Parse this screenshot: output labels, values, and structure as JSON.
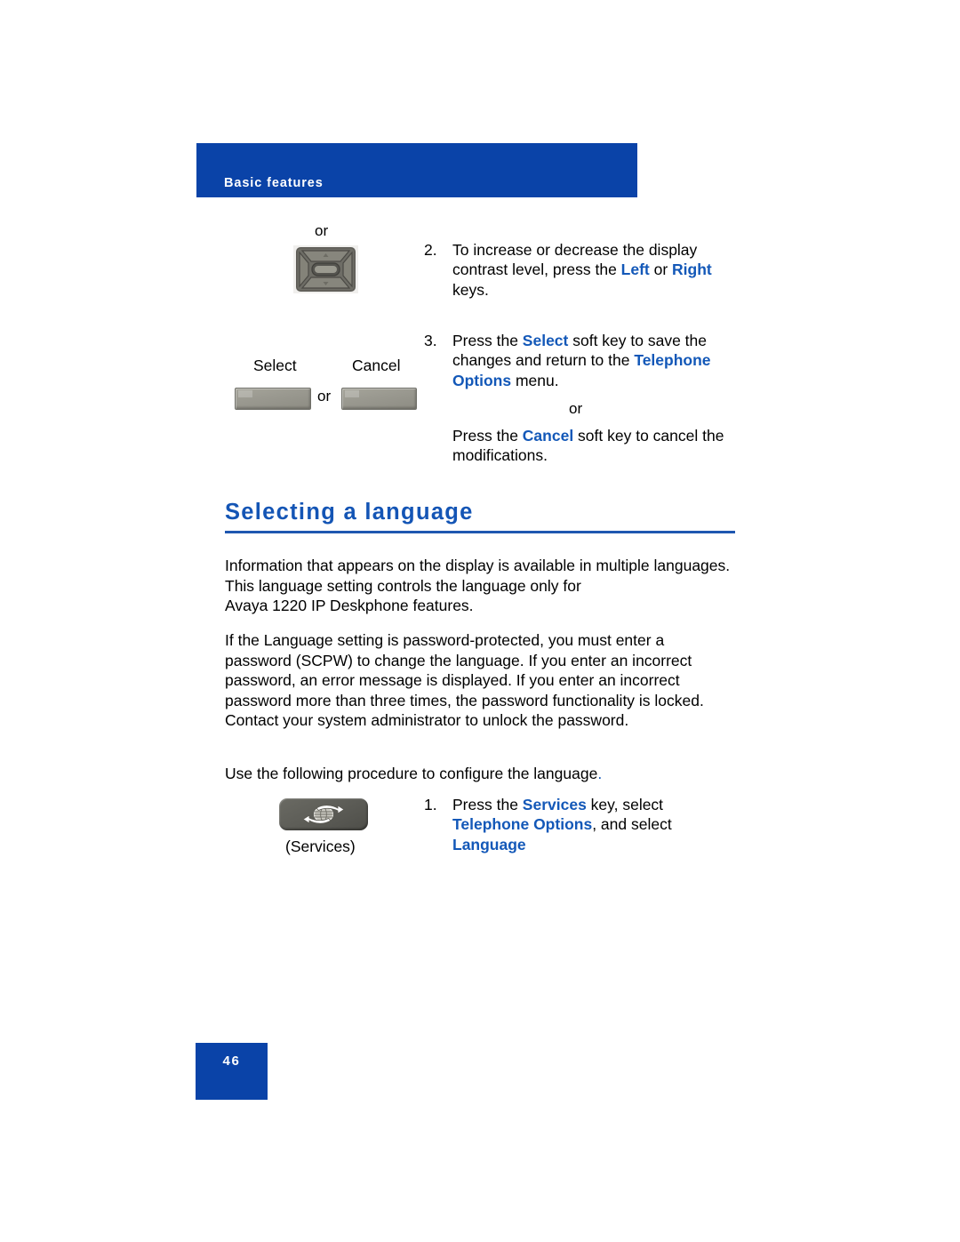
{
  "page": {
    "running_header": "Basic features",
    "page_number": "46",
    "accent_color": "#0a43a8",
    "link_color": "#1358b8"
  },
  "contrast_steps": {
    "or_above_navkey": "or",
    "navkey_icon": "navigation-cluster-key",
    "step2": {
      "number": "2.",
      "text_1": "To increase or decrease the display",
      "text_2a": "contrast level, press the ",
      "text_2b": "Left",
      "text_2c": " or ",
      "text_2d": "Right",
      "text_3": "keys."
    },
    "softkeys": {
      "select_label": "Select",
      "cancel_label": "Cancel",
      "or_between": "or"
    },
    "step3": {
      "number": "3.",
      "text_1a": "Press the ",
      "text_1b": "Select",
      "text_1c": " soft key to save the",
      "text_2a": "changes and return to the ",
      "text_2b": "Telephone",
      "text_3a": "Options",
      "text_3b": " menu."
    },
    "or_between_steps": "or",
    "cancel_sentence": {
      "text_1a": "Press the ",
      "text_1b": "Cancel",
      "text_1c": " soft key to cancel the",
      "text_2": "modifications."
    }
  },
  "section": {
    "heading": "Selecting a language",
    "paragraph_1": "Information that appears on the display is available in multiple languages.\nThis language setting controls the language only for\nAvaya 1220 IP Deskphone features.",
    "paragraph_2": "If the Language setting is password-protected, you must enter a\npassword (SCPW) to change the language. If you enter an incorrect\npassword, an error message is displayed. If you enter an incorrect\npassword more than three times, the password functionality is locked.\nContact your system administrator to unlock the password.",
    "paragraph_3_text": "Use the following procedure to configure the language",
    "paragraph_3_period": ".",
    "services_key": {
      "icon": "globe-with-arrows-icon",
      "label": "(Services)"
    },
    "step1": {
      "number": "1.",
      "text_1a": "Press the ",
      "text_1b": "Services",
      "text_1c": " key, select",
      "text_2a": "Telephone Options",
      "text_2b": ", and select",
      "text_3": "Language"
    }
  }
}
